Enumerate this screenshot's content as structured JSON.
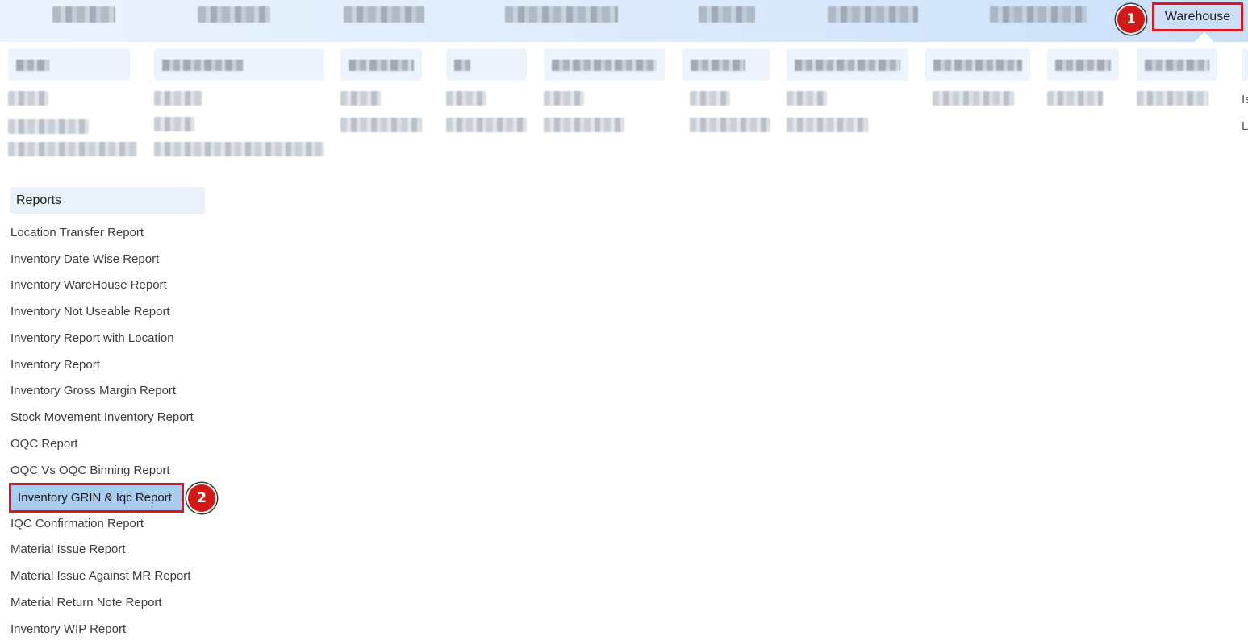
{
  "nav": {
    "active_label": "Warehouse",
    "step1": "1"
  },
  "menu_edge": {
    "letter1": "Is",
    "letter2": "L"
  },
  "reports": {
    "header": "Reports",
    "items": [
      "Location Transfer Report",
      "Inventory Date Wise Report",
      "Inventory WareHouse Report",
      "Inventory Not Useable Report",
      "Inventory Report with Location",
      "Inventory Report",
      "Inventory Gross Margin Report",
      "Stock Movement Inventory Report",
      "OQC Report",
      "OQC Vs OQC Binning Report",
      "Inventory GRIN & Iqc Report",
      "IQC Confirmation Report",
      "Material Issue Report",
      "Material Issue Against MR Report",
      "Material Return Note Report",
      "Inventory WIP Report"
    ],
    "selected_index": 10,
    "step2": "2"
  },
  "colors": {
    "highlight_border": "#e0141e",
    "badge": "#d31818",
    "selected_bg": "#a9cdf0"
  }
}
